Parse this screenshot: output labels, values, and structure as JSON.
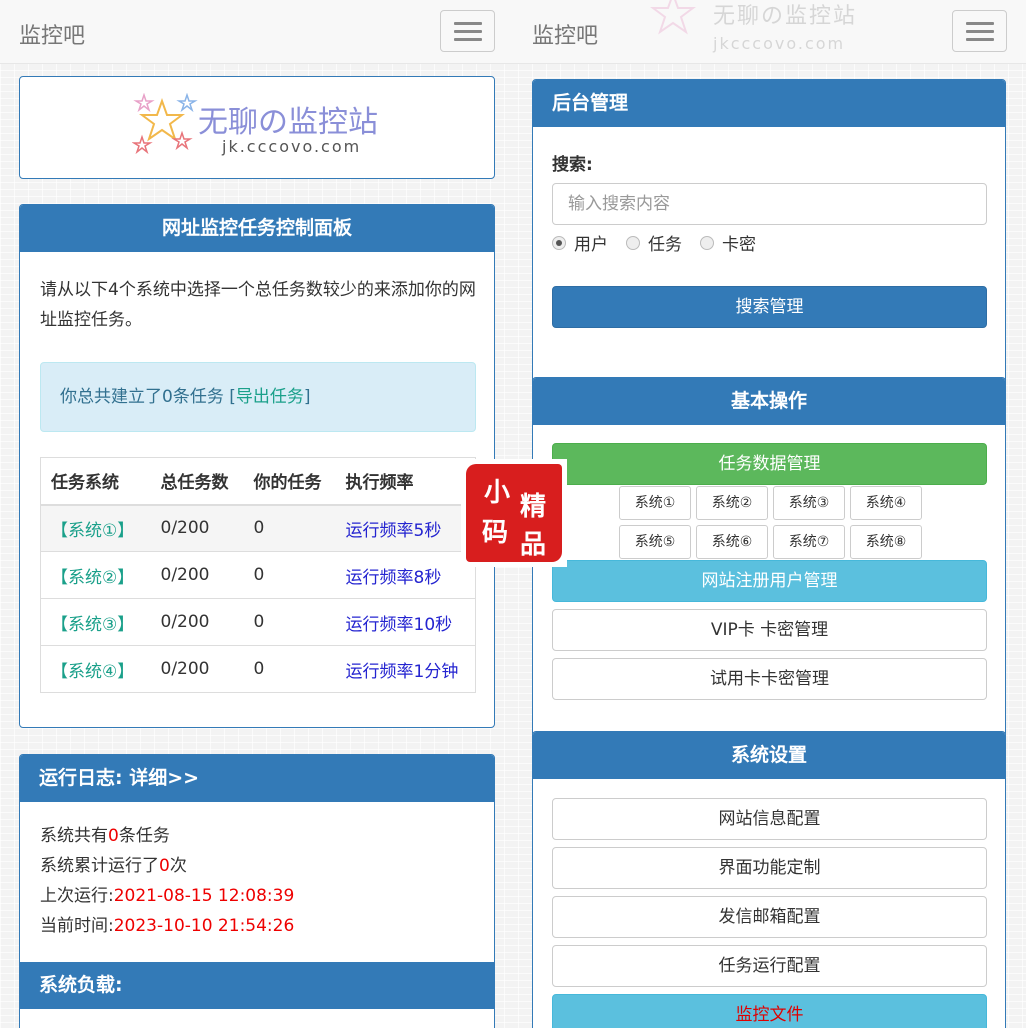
{
  "app": {
    "brand": "监控吧"
  },
  "watermark": {
    "title": "无聊の监控站",
    "domain": "jkcccovo.com"
  },
  "logo": {
    "title": "无聊の监控站",
    "domain": "jk.cccovo.com"
  },
  "monitor": {
    "heading": "网址监控任务控制面板",
    "intro": "请从以下4个系统中选择一个总任务数较少的来添加你的网址监控任务。",
    "alert_prefix": "你总共建立了0条任务 [",
    "alert_link": "导出任务",
    "alert_suffix": "]",
    "columns": [
      "任务系统",
      "总任务数",
      "你的任务",
      "执行频率"
    ],
    "rows": [
      {
        "system": "【系统①】",
        "total": "0/200",
        "mine": "0",
        "freq": "运行频率5秒"
      },
      {
        "system": "【系统②】",
        "total": "0/200",
        "mine": "0",
        "freq": "运行频率8秒"
      },
      {
        "system": "【系统③】",
        "total": "0/200",
        "mine": "0",
        "freq": "运行频率10秒"
      },
      {
        "system": "【系统④】",
        "total": "0/200",
        "mine": "0",
        "freq": "运行频率1分钟"
      }
    ]
  },
  "log": {
    "heading": "运行日志:  详细>>",
    "line1_prefix": "系统共有",
    "line1_value": "0",
    "line1_suffix": "条任务",
    "line2_prefix": "系统累计运行了",
    "line2_value": "0",
    "line2_suffix": "次",
    "line3_prefix": "上次运行:",
    "line3_value": "2021-08-15 12:08:39",
    "line4_prefix": "当前时间:",
    "line4_value": "2023-10-10 21:54:26",
    "load_heading": "系统负载:"
  },
  "admin": {
    "heading": "后台管理",
    "search_label": "搜索:",
    "search_placeholder": "输入搜索内容",
    "radios": [
      "用户",
      "任务",
      "卡密"
    ],
    "search_button": "搜索管理"
  },
  "basic": {
    "heading": "基本操作",
    "task_data_button": "任务数据管理",
    "systems": [
      "系统①",
      "系统②",
      "系统③",
      "系统④",
      "系统⑤",
      "系统⑥",
      "系统⑦",
      "系统⑧"
    ],
    "register_users_button": "网站注册用户管理",
    "vip_button": "VIP卡 卡密管理",
    "trial_button": "试用卡卡密管理"
  },
  "settings": {
    "heading": "系统设置",
    "site_info_button": "网站信息配置",
    "ui_custom_button": "界面功能定制",
    "mail_button": "发信邮箱配置",
    "task_run_button": "任务运行配置",
    "monitor_file_button": "监控文件"
  },
  "stamp": {
    "chars": [
      "小",
      "精",
      "码",
      "品"
    ]
  },
  "colors": {
    "primary": "#337ab7",
    "success": "#5cb85c",
    "info": "#5bc0de",
    "danger": "#e00000"
  }
}
